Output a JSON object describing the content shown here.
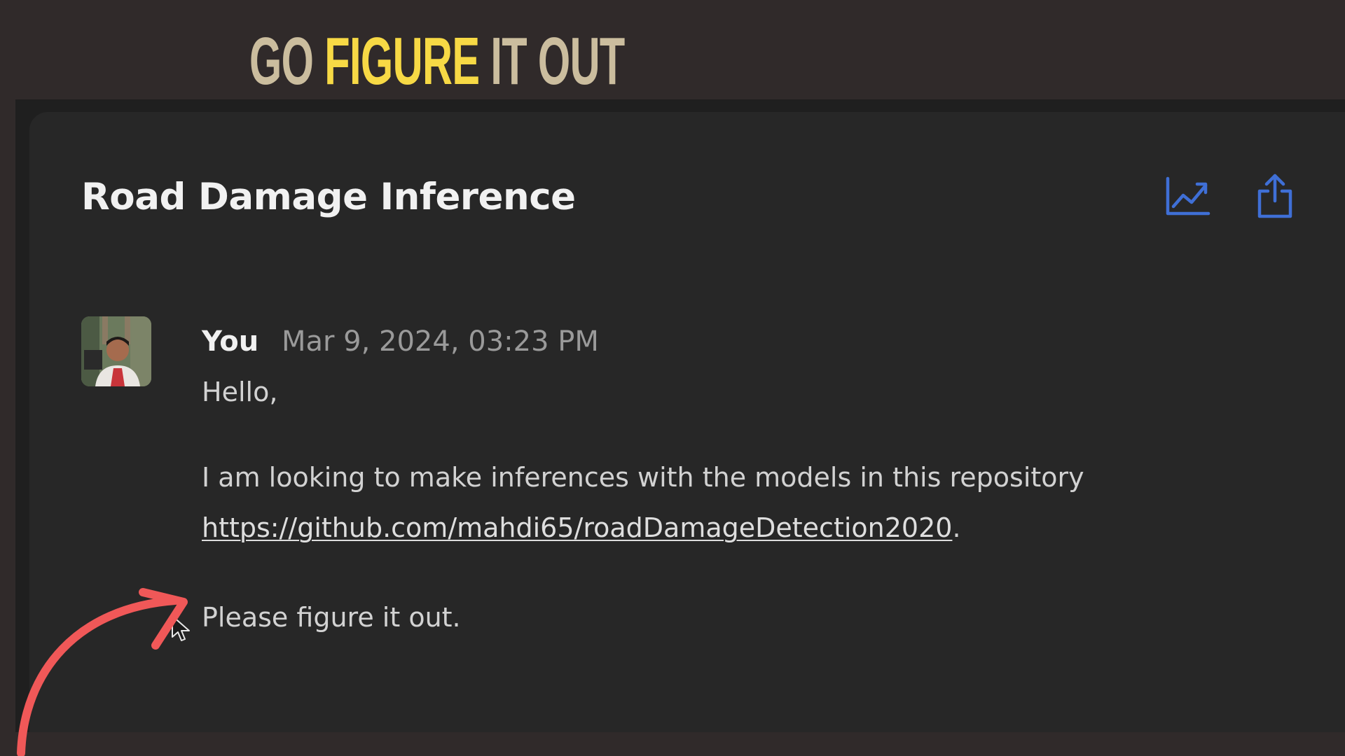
{
  "banner": {
    "word1": "GO",
    "word2": "FIGURE",
    "word3": "IT OUT"
  },
  "thread": {
    "title": "Road Damage Inference",
    "actions": [
      {
        "icon": "line-chart-icon",
        "color": "#3f6fd6"
      },
      {
        "icon": "share-icon",
        "color": "#3f6fd6"
      }
    ]
  },
  "message": {
    "author": "You",
    "timestamp": "Mar 9, 2024, 03:23 PM",
    "greeting": "Hello,",
    "body": "I am looking to make inferences with the models in this repository",
    "link": "https://github.com/mahdi65/roadDamageDetection2020",
    "link_suffix": ".",
    "closing": "Please figure it out."
  },
  "colors": {
    "background": "#302a2a",
    "panel": "#272727",
    "banner_beige": "#cbbd9e",
    "banner_yellow": "#f7d945",
    "accent_blue": "#3f6fd6",
    "annotation_red": "#f05858"
  }
}
